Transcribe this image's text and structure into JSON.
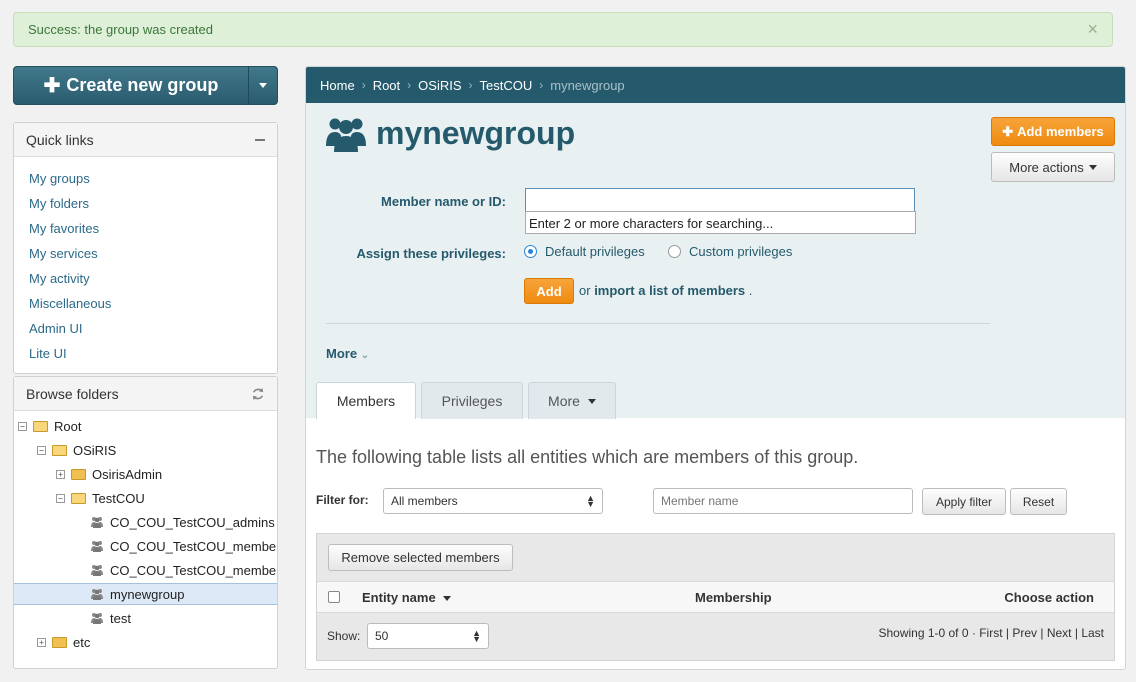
{
  "alert": {
    "text": "Success: the group was created",
    "close": "×"
  },
  "create_button": {
    "label": "Create new group"
  },
  "quick_links": {
    "title": "Quick links",
    "items": [
      "My groups",
      "My folders",
      "My favorites",
      "My services",
      "My activity",
      "Miscellaneous",
      "Admin UI",
      "Lite UI"
    ]
  },
  "browse": {
    "title": "Browse folders",
    "tree": [
      "Root",
      "OSiRIS",
      "OsirisAdmin",
      "TestCOU",
      "CO_COU_TestCOU_admins",
      "CO_COU_TestCOU_members",
      "CO_COU_TestCOU_members",
      "mynewgroup",
      "test",
      "etc"
    ],
    "toggles": [
      "−",
      "−",
      "+",
      "−",
      "+"
    ]
  },
  "breadcrumb": {
    "items": [
      "Home",
      "Root",
      "OSiRIS",
      "TestCOU"
    ],
    "current": "mynewgroup",
    "sep": "›"
  },
  "group": {
    "name": "mynewgroup"
  },
  "actions": {
    "add_members": "Add members",
    "more_actions": "More actions"
  },
  "form": {
    "member_label": "Member name or ID:",
    "member_value": "",
    "hint": "Enter 2 or more characters for searching...",
    "privileges_label": "Assign these privileges:",
    "default_privileges": "Default privileges",
    "custom_privileges": "Custom privileges",
    "add": "Add",
    "or": "or",
    "import_link": "import a list of members",
    "period": ".",
    "more": "More"
  },
  "tabs": [
    "Members",
    "Privileges",
    "More"
  ],
  "members": {
    "description": "The following table lists all entities which are members of this group.",
    "filter_label": "Filter for:",
    "filter_value": "All members",
    "name_placeholder": "Member name",
    "apply": "Apply filter",
    "reset": "Reset",
    "remove": "Remove selected members",
    "columns": [
      "Entity name",
      "Membership",
      "Choose action"
    ],
    "show_label": "Show:",
    "page_size": "50",
    "showing": "Showing 1-0 of 0",
    "pager": [
      "First",
      "Prev",
      "Next",
      "Last"
    ],
    "pager_sep": "·"
  },
  "colors": {
    "accent": "#245a6c",
    "orange": "#ef8a10",
    "success_bg": "#dff0d8"
  }
}
